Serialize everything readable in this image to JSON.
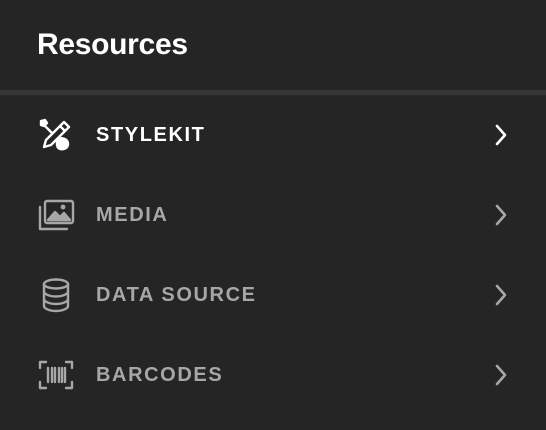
{
  "panel": {
    "title": "Resources"
  },
  "items": [
    {
      "label": "STYLEKIT",
      "icon": "brush-pencil-icon",
      "active": true
    },
    {
      "label": "MEDIA",
      "icon": "images-icon",
      "active": false
    },
    {
      "label": "DATA SOURCE",
      "icon": "database-icon",
      "active": false
    },
    {
      "label": "BARCODES",
      "icon": "barcode-scan-icon",
      "active": false
    }
  ],
  "colors": {
    "background": "#252525",
    "divider": "#363636",
    "active_text": "#ffffff",
    "inactive_text": "#a7a7a7"
  }
}
